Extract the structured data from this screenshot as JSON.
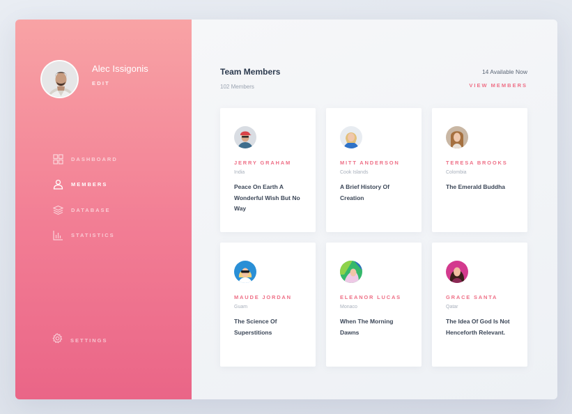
{
  "profile": {
    "name": "Alec Issigonis",
    "edit_label": "EDIT"
  },
  "nav": {
    "items": [
      {
        "label": "DASHBOARD",
        "icon": "dashboard-icon",
        "active": false
      },
      {
        "label": "MEMBERS",
        "icon": "user-icon",
        "active": true
      },
      {
        "label": "DATABASE",
        "icon": "layers-icon",
        "active": false
      },
      {
        "label": "STATISTICS",
        "icon": "bar-chart-icon",
        "active": false
      }
    ],
    "settings_label": "SETTINGS"
  },
  "header": {
    "title": "Team Members",
    "subtitle": "102 Members",
    "available": "14 Available Now",
    "view_members": "VIEW MEMBERS"
  },
  "colors": {
    "accent": "#ee6f86",
    "sidebar_top": "#f8a3a5",
    "sidebar_bottom": "#ea6587",
    "text_dark": "#2c3a4e"
  },
  "members": [
    {
      "name": "JERRY GRAHAM",
      "location": "India",
      "quote": "Peace On Earth A Wonderful Wish But No Way"
    },
    {
      "name": "MITT ANDERSON",
      "location": "Cook Islands",
      "quote": "A Brief History Of Creation"
    },
    {
      "name": "TERESA BROOKS",
      "location": "Colombia",
      "quote": "The Emerald Buddha"
    },
    {
      "name": "MAUDE JORDAN",
      "location": "Guam",
      "quote": "The Science Of Superstitions"
    },
    {
      "name": "ELEANOR LUCAS",
      "location": "Monaco",
      "quote": "When The Morning Dawns"
    },
    {
      "name": "GRACE SANTA",
      "location": "Qatar",
      "quote": "The Idea Of God Is Not Henceforth Relevant."
    }
  ]
}
